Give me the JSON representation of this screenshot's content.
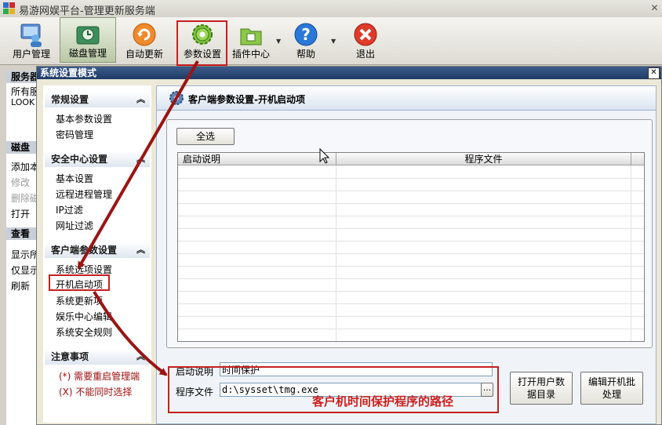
{
  "window": {
    "title": "易游网娱平台-管理更新服务端",
    "close_glyph": "✕"
  },
  "toolbar": {
    "items": [
      {
        "label": "用户管理",
        "icon": "users-icon"
      },
      {
        "label": "磁盘管理",
        "icon": "disk-icon"
      },
      {
        "label": "自动更新",
        "icon": "refresh-icon"
      },
      {
        "label": "参数设置",
        "icon": "gear-icon"
      },
      {
        "label": "插件中心",
        "icon": "plugin-icon"
      },
      {
        "label": "帮助",
        "icon": "help-icon"
      },
      {
        "label": "退出",
        "icon": "exit-icon"
      }
    ],
    "dropdown_glyph": "▼"
  },
  "left_panel": {
    "sections": [
      {
        "title": "服务器",
        "items": [
          "所有服",
          "LOOK"
        ]
      },
      {
        "title": "磁盘",
        "items": [
          "添加本",
          "修改",
          "删除磁",
          "打开"
        ]
      },
      {
        "title": "查看",
        "items": [
          "显示所",
          "仅显示",
          "刷新"
        ]
      }
    ]
  },
  "dialog": {
    "title": "系统设置模式",
    "close_glyph": "✕",
    "nav": {
      "groups": [
        {
          "title": "常规设置",
          "items": [
            "基本参数设置",
            "密码管理"
          ]
        },
        {
          "title": "安全中心设置",
          "items": [
            "基本设置",
            "远程进程管理",
            "IP过滤",
            "网址过滤"
          ]
        },
        {
          "title": "客户端参数设置",
          "items": [
            "系统选项设置",
            "开机启动项",
            "系统更新项",
            "娱乐中心编辑",
            "系统安全规则"
          ]
        }
      ],
      "chevron": "︽",
      "notes_title": "注意事项",
      "notes": [
        "(*) 需要重启管理端",
        "(X) 不能同时选择"
      ]
    },
    "content": {
      "header": "客户端参数设置-开机启动项",
      "select_all": "全选",
      "columns": [
        "启动说明",
        "程序文件"
      ],
      "form": {
        "desc_label": "启动说明",
        "desc_value": "时间保护",
        "file_label": "程序文件",
        "file_value": "d:\\sysset\\tmg.exe",
        "browse": "..."
      },
      "btn_open_user_dir": "打开用户数据目录",
      "btn_edit_batch": "编辑开机批处理"
    }
  },
  "annotation": {
    "text": "客户机时间保护程序的路径",
    "color": "#cc1f1f"
  },
  "colors": {
    "accent": "#1e3b66",
    "highlight": "#c62020",
    "arrow": "#9a1515"
  }
}
